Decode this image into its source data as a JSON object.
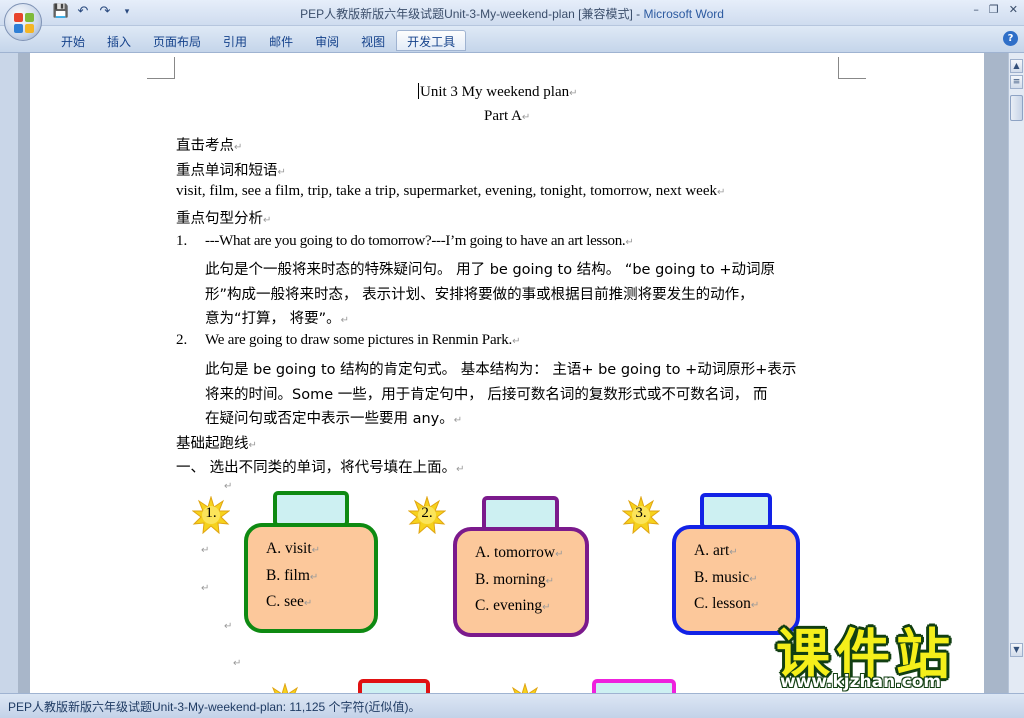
{
  "window": {
    "title": "PEP人教版新版六年级试题Unit-3-My-weekend-plan [兼容模式]",
    "app_name": "Microsoft Word",
    "controls": [
      "–",
      "❐",
      "✕"
    ]
  },
  "quick_access": {
    "save_icon": "save-icon",
    "undo_icon": "undo-icon",
    "redo_icon": "redo-icon",
    "customize_icon": "customize-icon"
  },
  "ribbon": {
    "tabs": [
      "开始",
      "插入",
      "页面布局",
      "引用",
      "邮件",
      "审阅",
      "视图",
      "开发工具"
    ],
    "active_tab": "开发工具",
    "help": "?"
  },
  "document": {
    "title": "Unit 3  My weekend plan",
    "subtitle": "Part A",
    "lines": {
      "l1": "直击考点",
      "l2": "重点单词和短语",
      "l3": "visit, film, see a film, trip, take a trip, supermarket, evening, tonight, tomorrow, next week",
      "l4": "重点句型分析",
      "n1": "1.",
      "l5": "---What are you going to do tomorrow?---I’m going to have an art lesson.",
      "l6": "此句是个一般将来时态的特殊疑问句。 用了 be going to  结构。 “be going to +动词原",
      "l7": "形”构成一般将来时态，  表示计划、安排将要做的事或根据目前推测将要发生的动作，",
      "l8": "意为“打算，  将要”。",
      "n2": "2.",
      "l9": "We are going to draw some pictures in Renmin Park.",
      "l10": "此句是 be going to  结构的肯定句式。 基本结构为：  主语+ be going to +动词原形+表示",
      "l11": "将来的时间。Some 一些，用于肯定句中，  后接可数名词的复数形式或不可数名词，  而",
      "l12": "在疑问句或否定中表示一些要用 any。",
      "l13": "基础起跑线",
      "l14": "一、  选出不同类的单词，将代号填在上面。"
    },
    "para_mark": "↵",
    "groups": [
      {
        "num": "1.",
        "options": [
          "A. visit",
          "B. film",
          "C. see"
        ],
        "border_color": "#0e8a12"
      },
      {
        "num": "2.",
        "options": [
          "A. tomorrow",
          "B. morning",
          "C. evening"
        ],
        "border_color": "#7b1a8c"
      },
      {
        "num": "3.",
        "options": [
          "A. art",
          "B. music",
          "C. lesson"
        ],
        "border_color": "#1222e6"
      }
    ],
    "lower_lid_colors": [
      "#e01212",
      "#ee22dd"
    ]
  },
  "status_bar": {
    "text": "PEP人教版新版六年级试题Unit-3-My-weekend-plan: 11,125 个字符(近似值)。"
  },
  "watermark": {
    "text": "课件站",
    "url": "www.kjzhan.com"
  }
}
